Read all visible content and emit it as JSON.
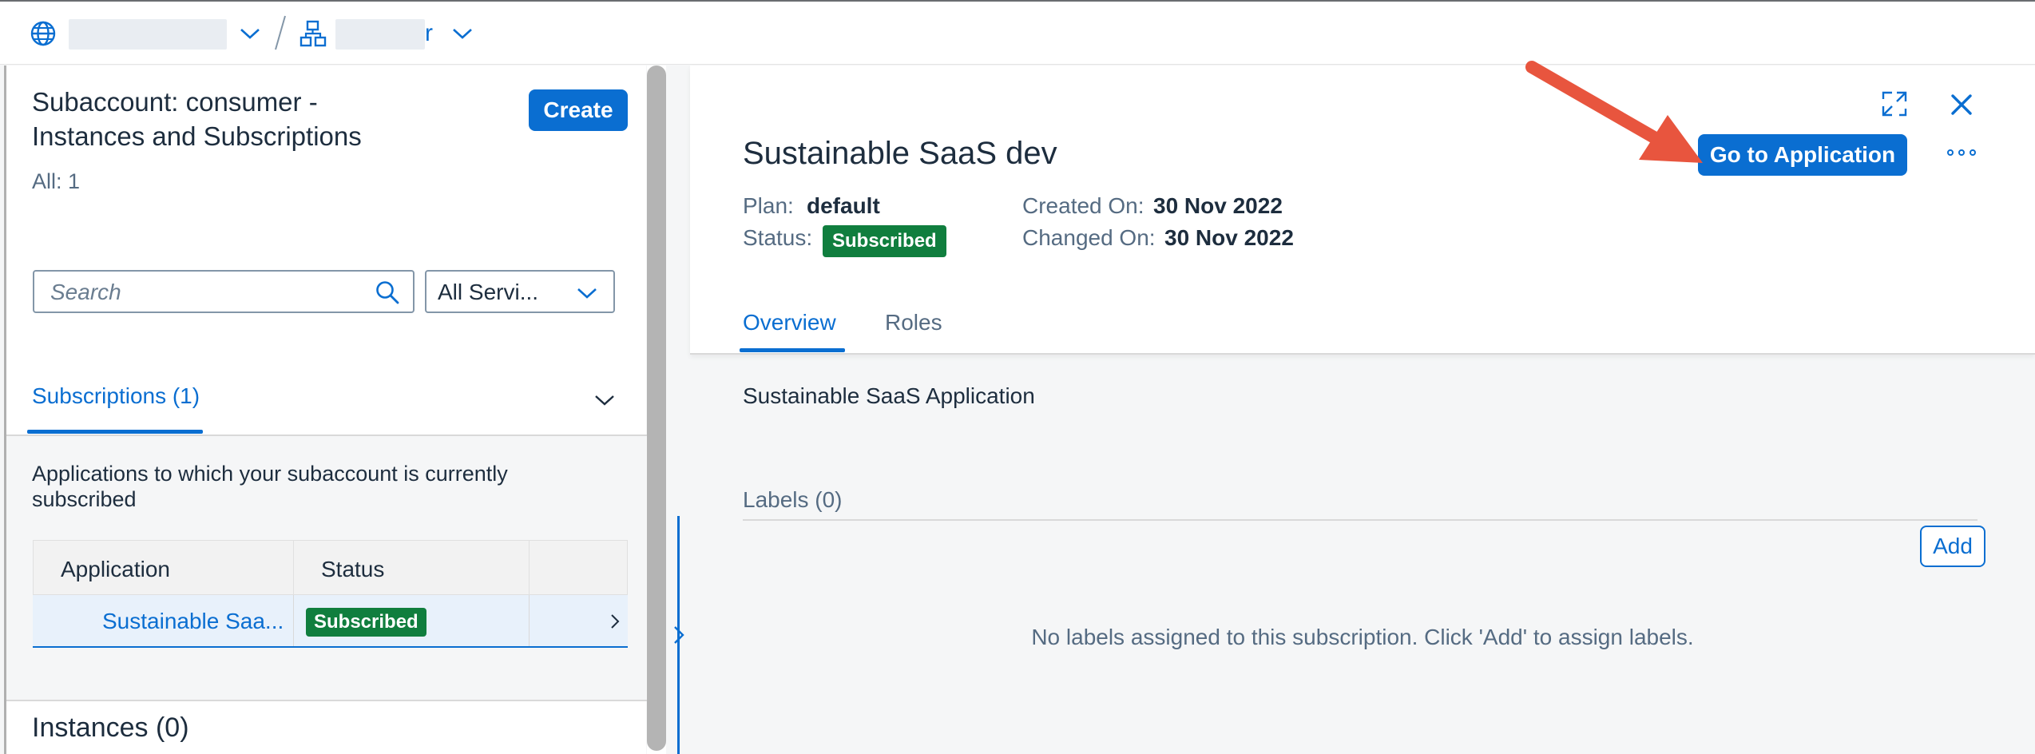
{
  "breadcrumb": {
    "global_account_label": "███████",
    "subaccount_suffix": "r"
  },
  "left_panel": {
    "title": "Subaccount: consumer - Instances and Subscriptions",
    "count": "All: 1",
    "create_label": "Create",
    "search_placeholder": "Search",
    "service_filter": "All Servi...",
    "subscriptions_tab": "Subscriptions (1)",
    "subscriptions_description": "Applications to which your subaccount is currently subscribed",
    "table": {
      "headers": [
        "Application",
        "Status"
      ],
      "rows": [
        {
          "application": "Sustainable Saa...",
          "status": "Subscribed"
        }
      ]
    },
    "instances_title": "Instances (0)"
  },
  "detail": {
    "title": "Sustainable SaaS dev",
    "goto_label": "Go to Application",
    "plan_label": "Plan:",
    "plan_value": "default",
    "status_label": "Status:",
    "status_value": "Subscribed",
    "created_label": "Created On:",
    "created_value": "30 Nov 2022",
    "changed_label": "Changed On:",
    "changed_value": "30 Nov 2022",
    "tabs": [
      "Overview",
      "Roles"
    ],
    "description": "Sustainable SaaS Application",
    "labels_title": "Labels (0)",
    "add_label": "Add",
    "empty_labels": "No labels assigned to this subscription. Click 'Add' to assign labels."
  },
  "colors": {
    "accent": "#0a6ed1",
    "success": "#107e3e",
    "annotation_arrow": "#e8553e"
  },
  "icons": [
    "globe-icon",
    "subaccount-icon",
    "chevron-down-icon",
    "search-icon",
    "expand-icon",
    "close-icon",
    "more-icon",
    "chevron-right-icon"
  ]
}
